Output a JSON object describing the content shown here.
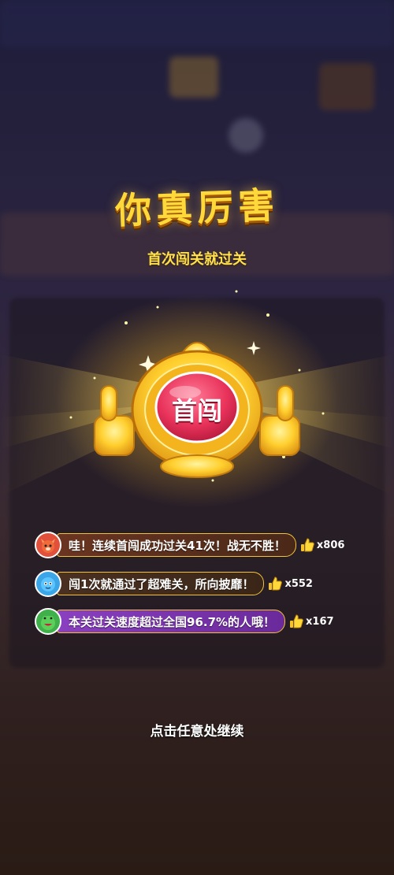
{
  "title": "你真厉害",
  "subtitle": "首次闯关就过关",
  "badge": {
    "label": "首闯"
  },
  "messages": [
    {
      "avatar": "fox-avatar-icon",
      "text": "哇！连续首闯成功过关41次！战无不胜！",
      "likes": "x806",
      "color": "#5a2a1c"
    },
    {
      "avatar": "blue-creature-avatar-icon",
      "text": "闯1次就通过了超难关，所向披靡！",
      "likes": "x552",
      "color": "#3a2a1c"
    },
    {
      "avatar": "frog-avatar-icon",
      "text": "本关过关速度超过全国96.7%的人哦！",
      "likes": "x167",
      "color": "#7a3aa8"
    }
  ],
  "continue_text": "点击任意处继续",
  "colors": {
    "gold": "#ffd93a",
    "badge_red": "#e8325a",
    "accent_purple": "#7a3aa8"
  }
}
